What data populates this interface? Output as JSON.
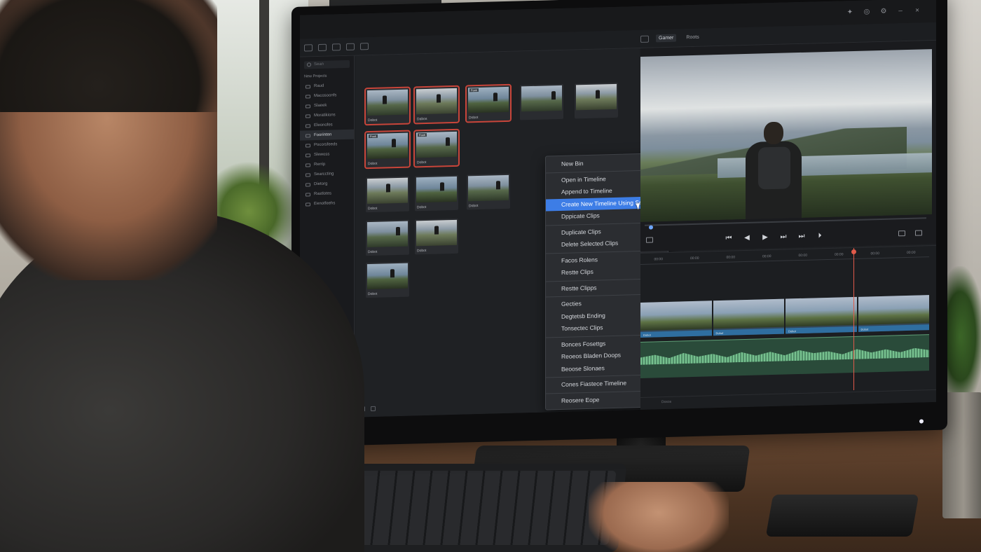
{
  "viewer_tabs": [
    "Gamer",
    "Roots"
  ],
  "sidebar": {
    "search_placeholder": "Sean",
    "heading": "New Projects",
    "items": [
      {
        "label": "Raud",
        "active": false
      },
      {
        "label": "Macosoonfs",
        "active": false
      },
      {
        "label": "Slaeek",
        "active": false
      },
      {
        "label": "Moratikions",
        "active": false
      },
      {
        "label": "Eleonofes",
        "active": false
      },
      {
        "label": "Foorinten",
        "active": true
      },
      {
        "label": "Pocorsfeeds",
        "active": false
      },
      {
        "label": "Slewoss",
        "active": false
      },
      {
        "label": "Rerrip",
        "active": false
      },
      {
        "label": "Searccting",
        "active": false
      },
      {
        "label": "Dietorg",
        "active": false
      },
      {
        "label": "Rastlotes",
        "active": false
      },
      {
        "label": "Eenotfeehs",
        "active": false
      }
    ]
  },
  "clips": [
    {
      "caption": "Dobot",
      "tag": "",
      "selected": true
    },
    {
      "caption": "Dabos",
      "tag": "",
      "selected": true
    },
    {
      "caption": "Dobot",
      "tag": "Fook",
      "selected": true
    },
    {
      "caption": "",
      "tag": "",
      "selected": false
    },
    {
      "caption": "",
      "tag": "",
      "selected": false
    },
    {
      "caption": "Dobot",
      "tag": "Fook",
      "selected": true
    },
    {
      "caption": "Dobot",
      "tag": "Fook",
      "selected": true
    },
    {
      "caption": "Dobot",
      "tag": "",
      "selected": false
    },
    {
      "caption": "Dobot",
      "tag": "",
      "selected": false
    },
    {
      "caption": "Dobot",
      "tag": "",
      "selected": false
    },
    {
      "caption": "Dobot",
      "tag": "",
      "selected": false
    },
    {
      "caption": "Dobot",
      "tag": "",
      "selected": false
    },
    {
      "caption": "Dobot",
      "tag": "",
      "selected": false
    }
  ],
  "context_menu": {
    "items": [
      {
        "label": "New Bin",
        "submenu": true,
        "sep_after": true
      },
      {
        "label": "Open in Timeline",
        "submenu": false,
        "sep_after": false
      },
      {
        "label": "Append to Timeline",
        "submenu": true,
        "sep_after": false
      },
      {
        "label": "Create New Timeline Using Selected Clips",
        "submenu": false,
        "highlight": true,
        "sep_after": false
      },
      {
        "label": "Dppicate Clips",
        "submenu": false,
        "sep_after": true
      },
      {
        "label": "Duplicate Clips",
        "submenu": false,
        "sep_after": false
      },
      {
        "label": "Delete Selected Clips",
        "submenu": false,
        "sep_after": true
      },
      {
        "label": "Facos Rolens",
        "submenu": true,
        "sep_after": false
      },
      {
        "label": "Restte Clips",
        "submenu": false,
        "sep_after": true
      },
      {
        "label": "Restte Clipps",
        "submenu": true,
        "sep_after": true
      },
      {
        "label": "Gecties",
        "submenu": true,
        "sep_after": false
      },
      {
        "label": "Degtetsb Ending",
        "submenu": true,
        "sep_after": false
      },
      {
        "label": "Tonsectec Clips",
        "submenu": true,
        "sep_after": true
      },
      {
        "label": "Bonces Fosettgs",
        "submenu": true,
        "sep_after": false
      },
      {
        "label": "Reoeos Bladen Doops",
        "submenu": false,
        "sep_after": false
      },
      {
        "label": "Beoose Slonaes",
        "submenu": false,
        "sep_after": true
      },
      {
        "label": "Cones Fiastece Timeline",
        "submenu": false,
        "sep_after": true
      },
      {
        "label": "Reosere Eope",
        "submenu": true,
        "sep_after": false
      }
    ]
  },
  "ruler_marks": [
    "00:00",
    "00:00",
    "00:00",
    "00:00",
    "00:00",
    "00:00",
    "00:00",
    "00:00"
  ],
  "timeline_segments": [
    {
      "caption": "Dobot"
    },
    {
      "caption": "Dobot"
    },
    {
      "caption": "Dobot"
    },
    {
      "caption": "Dobot"
    }
  ],
  "timeline_footer": "Dosos",
  "colors": {
    "menu_highlight": "#3d7de6",
    "selection_outline": "#c8453a",
    "playhead": "#e05a4a",
    "audio_wave": "#77c18f",
    "video_track": "#2f6ea0"
  }
}
